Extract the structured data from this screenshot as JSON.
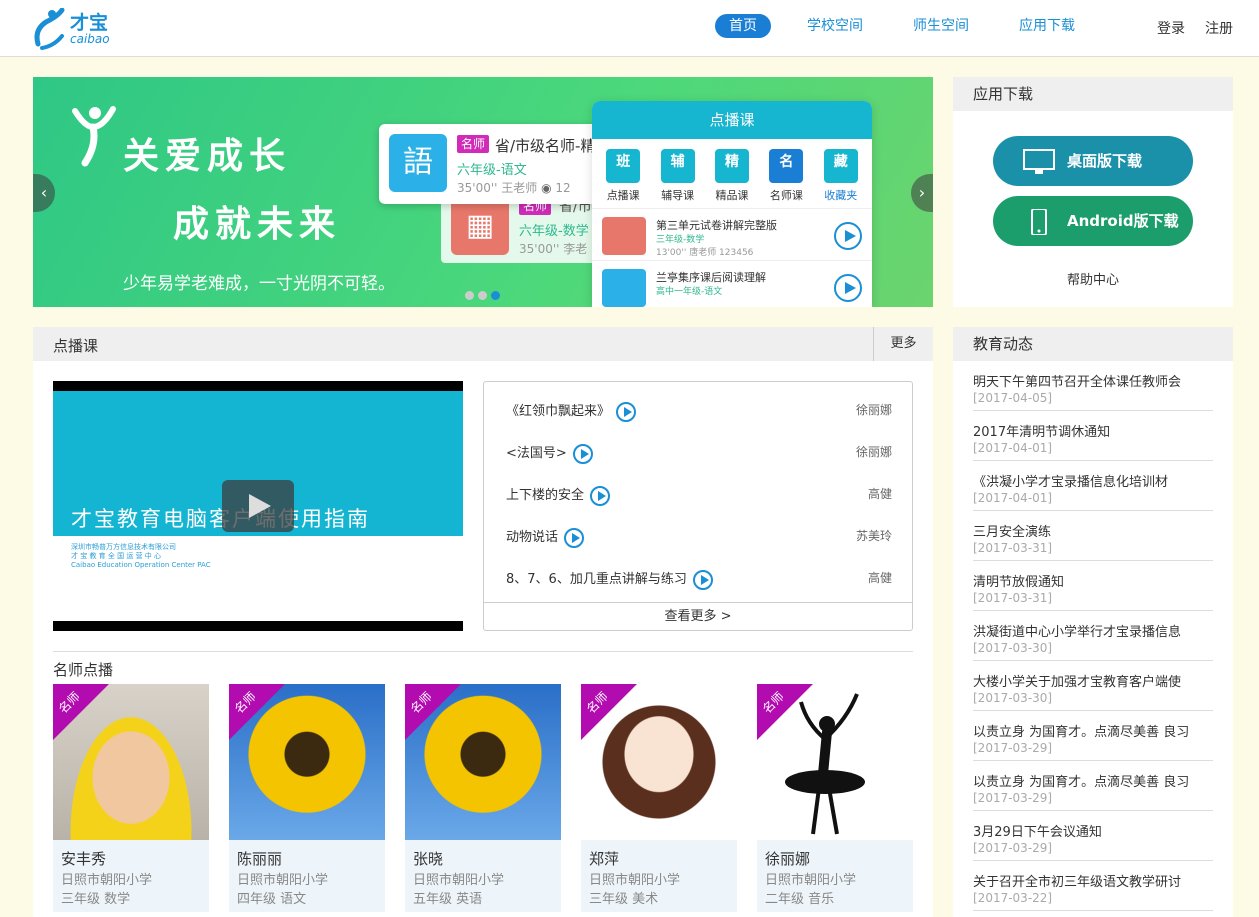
{
  "header": {
    "logo_name": "才宝",
    "logo_sub": "caibao",
    "nav": [
      "首页",
      "学校空间",
      "师生空间",
      "应用下载"
    ],
    "login": "登录",
    "register": "注册"
  },
  "banner": {
    "title1": "关爱成长",
    "title2": "成就未来",
    "subtitle": "少年易学老难成，一寸光阴不可轻。",
    "card_a": {
      "tag": "名师",
      "title": "省/市级名师-精",
      "grade": "六年级-语文",
      "meta": "35'00''  王老师",
      "views": "12"
    },
    "card_b": {
      "tag": "名师",
      "title": "省/市",
      "grade": "六年级-数学",
      "meta": "35'00''  李老"
    },
    "phone": {
      "title": "点播课",
      "tabs": [
        {
          "icon": "班",
          "label": "点播课"
        },
        {
          "icon": "辅",
          "label": "辅导课"
        },
        {
          "icon": "精",
          "label": "精品课"
        },
        {
          "icon": "名",
          "label": "名师课"
        },
        {
          "icon": "藏",
          "label": "收藏夹"
        }
      ],
      "rows": [
        {
          "title": "第三单元试卷讲解完整版",
          "grade": "三年级-数学",
          "meta": "13'00''  唐老师  123456"
        },
        {
          "title": "兰亭集序课后阅读理解",
          "grade": "高中一年级-语文",
          "meta": ""
        }
      ]
    }
  },
  "download": {
    "title": "应用下载",
    "desktop": "桌面版下载",
    "android": "Android版下载",
    "help": "帮助中心"
  },
  "news": {
    "title": "教育动态",
    "items": [
      {
        "title": "明天下午第四节召开全体课任教师会",
        "date": "[2017-04-05]"
      },
      {
        "title": "2017年清明节调休通知",
        "date": "[2017-04-01]"
      },
      {
        "title": "《洪凝小学才宝录播信息化培训材",
        "date": "[2017-04-01]"
      },
      {
        "title": "三月安全演练",
        "date": "[2017-03-31]"
      },
      {
        "title": "清明节放假通知",
        "date": "[2017-03-31]"
      },
      {
        "title": "洪凝街道中心小学举行才宝录播信息",
        "date": "[2017-03-30]"
      },
      {
        "title": "大楼小学关于加强才宝教育客户端使",
        "date": "[2017-03-30]"
      },
      {
        "title": "以责立身 为国育才。点滴尽美善 良习",
        "date": "[2017-03-29]"
      },
      {
        "title": "以责立身 为国育才。点滴尽美善 良习",
        "date": "[2017-03-29]"
      },
      {
        "title": "3月29日下午会议通知",
        "date": "[2017-03-29]"
      },
      {
        "title": "关于召开全市初三年级语文教学研讨",
        "date": "[2017-03-22]"
      }
    ]
  },
  "courses": {
    "title": "点播课",
    "more": "更多",
    "video_title": "才宝教育电脑客户端使用指南",
    "video_small_1": "深圳市畅普万方信息技术有限公司",
    "video_small_2": "才 宝 教 育 全 国 运 营 中 心",
    "video_small_3": "Caibao Education Operation Center PAC",
    "list": [
      {
        "title": "《红领巾飘起来》",
        "author": "徐丽娜"
      },
      {
        "title": "<法国号>",
        "author": "徐丽娜"
      },
      {
        "title": "上下楼的安全",
        "author": "高健"
      },
      {
        "title": "动物说话",
        "author": "苏美玲"
      },
      {
        "title": "8、7、6、加几重点讲解与练习",
        "author": "高健"
      }
    ],
    "list_more": "查看更多 >"
  },
  "teachers": {
    "title": "名师点播",
    "badge": "名师",
    "items": [
      {
        "name": "安丰秀",
        "school": "日照市朝阳小学",
        "class": "三年级 数学"
      },
      {
        "name": "陈丽丽",
        "school": "日照市朝阳小学",
        "class": "四年级 语文"
      },
      {
        "name": "张晓",
        "school": "日照市朝阳小学",
        "class": "五年级 英语"
      },
      {
        "name": "郑萍",
        "school": "日照市朝阳小学",
        "class": "三年级 美术"
      },
      {
        "name": "徐丽娜",
        "school": "日照市朝阳小学",
        "class": "二年级 音乐"
      }
    ]
  }
}
